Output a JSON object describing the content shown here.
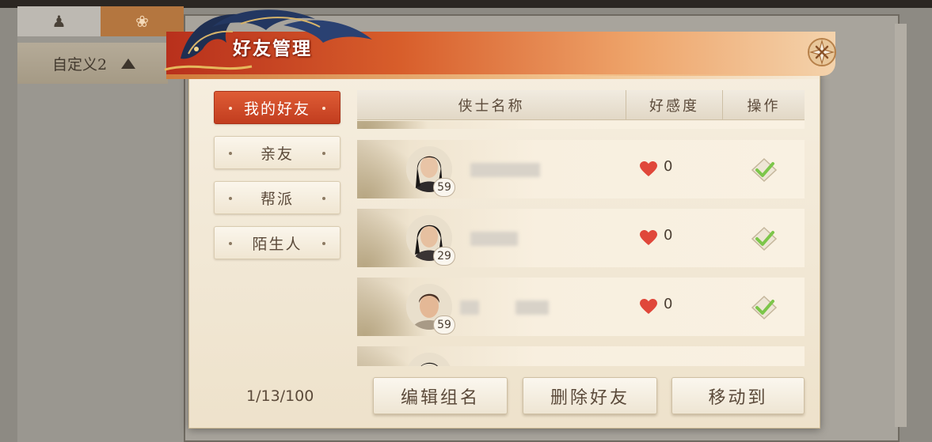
{
  "background": {
    "group_label": "自定义2",
    "tab_icons": [
      "character-icon",
      "rabbit-icon"
    ]
  },
  "modal": {
    "title": "好友管理",
    "close_icon": "close-icon"
  },
  "categories": [
    {
      "label": "我的好友",
      "active": true
    },
    {
      "label": "亲友",
      "active": false
    },
    {
      "label": "帮派",
      "active": false
    },
    {
      "label": "陌生人",
      "active": false
    }
  ],
  "counter": "1/13/100",
  "table": {
    "headers": {
      "name": "侠士名称",
      "affinity": "好感度",
      "action": "操作"
    },
    "rows": [
      {
        "level": "59",
        "affinity": "0",
        "selected": true
      },
      {
        "level": "29",
        "affinity": "0",
        "selected": true
      },
      {
        "level": "59",
        "affinity": "0",
        "selected": true
      }
    ]
  },
  "buttons": {
    "edit": "编辑组名",
    "delete": "删除好友",
    "move": "移动到"
  },
  "colors": {
    "active_tab": "#c23d1f",
    "heart": "#e0473a",
    "check": "#7cc64a"
  }
}
